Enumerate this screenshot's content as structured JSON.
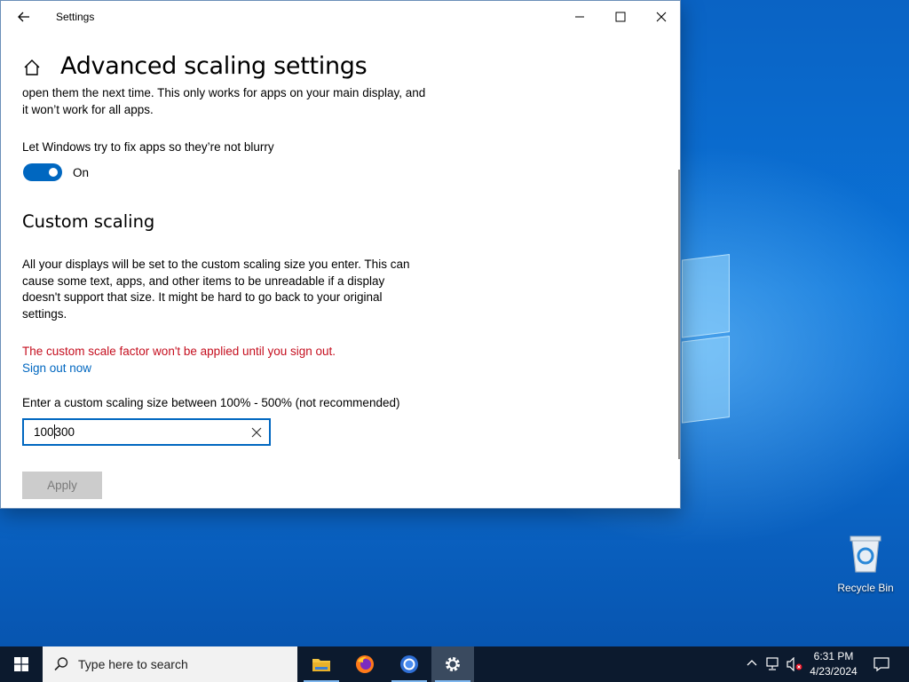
{
  "window": {
    "title": "Settings",
    "page_title": "Advanced scaling settings"
  },
  "content": {
    "intro_text": "open them the next time. This only works for apps on your main display, and it won’t work for all apps.",
    "toggle_label": "Let Windows try to fix apps so they’re not blurry",
    "toggle_state": "On",
    "section_title": "Custom scaling",
    "custom_description": "All your displays will be set to the custom scaling size you enter. This can cause some text, apps, and other items to be unreadable if a display doesn't support that size. It might be hard to go back to your original settings.",
    "warning": "The custom scale factor won't be applied until you sign out.",
    "sign_out_link": "Sign out now",
    "input_label": "Enter a custom scaling size between 100% - 500% (not recommended)",
    "input_value_before_caret": "100",
    "input_value_after_caret": "300",
    "apply_button": "Apply"
  },
  "desktop": {
    "recycle_bin_label": "Recycle Bin"
  },
  "taskbar": {
    "search_placeholder": "Type here to search",
    "apps": [
      "file-explorer-icon",
      "firefox-icon",
      "chrome-icon",
      "settings-icon"
    ],
    "time": "6:31 PM",
    "date": "4/23/2024"
  },
  "colors": {
    "accent": "#0067c0",
    "warning": "#c50f1f",
    "taskbar": "#0c1a2e"
  }
}
